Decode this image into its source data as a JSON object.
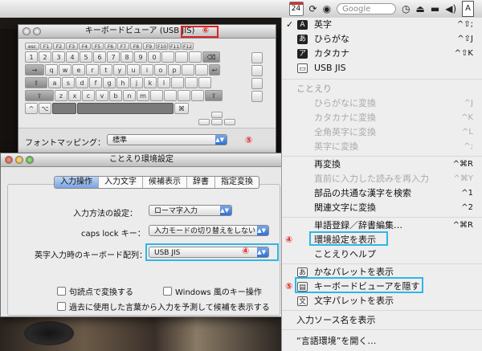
{
  "menubar": {
    "clock": "24",
    "search_placeholder": "Google",
    "icons": [
      "calendar-icon",
      "sync-icon",
      "globe-icon",
      "time-machine-icon",
      "eject-icon",
      "display-icon",
      "volume-icon",
      "input-menu-icon"
    ]
  },
  "keyboard_viewer": {
    "title": "キーボードビューア",
    "title_highlight": "(USB JIS)",
    "marker": "⑥",
    "esc": "esc",
    "fkeys": [
      "F1",
      "F2",
      "F3",
      "F4",
      "F5",
      "F6",
      "F7",
      "F8",
      "F9",
      "F10",
      "F11",
      "F12"
    ],
    "row_tab": "→",
    "row_caps": "⇪",
    "row_shift": "⇧",
    "row_ctrl": "^",
    "row_opt": "⌥",
    "row_cmd": "⌘",
    "row_return": "↩",
    "row_delete": "⌫",
    "keys_q": [
      "q",
      "w",
      "e",
      "r",
      "t",
      "y",
      "u",
      "i",
      "o",
      "p"
    ],
    "keys_a": [
      "a",
      "s",
      "d",
      "f",
      "g",
      "h",
      "j",
      "k",
      "l"
    ],
    "keys_z": [
      "z",
      "x",
      "c",
      "v",
      "b",
      "n",
      "m"
    ],
    "keys_num": [
      "1",
      "2",
      "3",
      "4",
      "5",
      "6",
      "7",
      "8",
      "9",
      "0"
    ],
    "mapping_label": "フォントマッピング：",
    "mapping_value": "標準",
    "mapping_marker": "⑤"
  },
  "prefs": {
    "title": "ことえり環境設定",
    "tabs": [
      "入力操作",
      "入力文字",
      "候補表示",
      "辞書",
      "指定変換"
    ],
    "input_method_label": "入力方法の設定：",
    "input_method_value": "ローマ字入力",
    "capslock_label": "caps lock キー：",
    "capslock_value": "入力モードの切り替えをしない",
    "keyboard_label": "英字入力時のキーボード配列：",
    "keyboard_value": "USB JIS",
    "keyboard_marker": "④",
    "cb1": "句読点で変換する",
    "cb2": "Windows 風のキー操作",
    "cb3": "過去に使用した言葉から入力を予測して候補を表示する"
  },
  "menu": {
    "eiji": "英字",
    "eiji_sc": "^⇧;",
    "hira": "ひらがな",
    "hira_sc": "^⇧J",
    "kata": "カタカナ",
    "kata_sc": "^⇧K",
    "usbjis": "USB JIS",
    "kotoeri_header": "ことえり",
    "d1": "ひらがなに変換",
    "d1_sc": "^J",
    "d2": "カタカナに変換",
    "d2_sc": "^K",
    "d3": "全角英字に変換",
    "d3_sc": "^L",
    "d4": "英字に変換",
    "d4_sc": "^;",
    "saihenkan": "再変換",
    "saihenkan_sc": "^⌘R",
    "choku": "直前に入力した読みを再入力",
    "choku_sc": "^⌘Y",
    "bubun": "部品の共通な漢字を検索",
    "bubun_sc": "^1",
    "kanren": "関連文字に変換",
    "kanren_sc": "^2",
    "tango": "単語登録／辞書編集…",
    "tango_sc": "^⌘R",
    "kankyo": "環境設定を表示",
    "help": "ことえりヘルプ",
    "kana_palette": "かなパレットを表示",
    "kbd_viewer": "キーボードビューアを隠す",
    "moji_palette": "文字パレットを表示",
    "source_name": "入力ソース名を表示",
    "gengo": "“言語環境”を開く…",
    "marker4": "④",
    "marker5": "⑤"
  }
}
